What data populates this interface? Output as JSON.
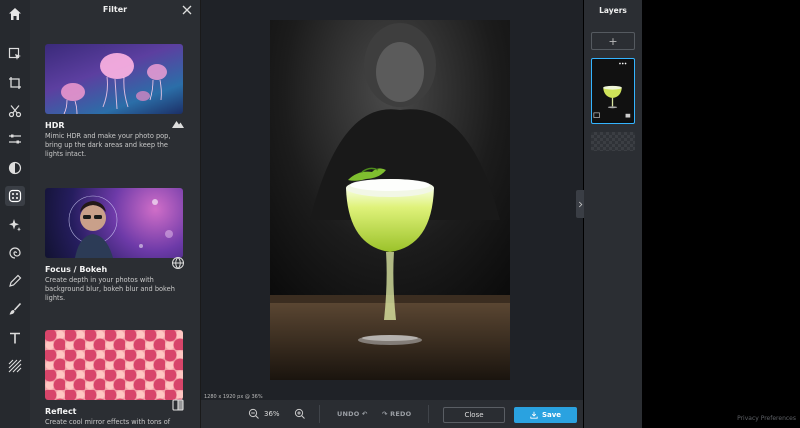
{
  "filter_panel": {
    "title": "Filter",
    "cards": [
      {
        "title": "HDR",
        "desc": "Mimic HDR and make your photo pop, bring up the dark areas and keep the lights intact.",
        "icon": "mountain-icon"
      },
      {
        "title": "Focus / Bokeh",
        "desc": "Create depth in your photos with background blur, bokeh blur and bokeh lights.",
        "icon": "globe-icon"
      },
      {
        "title": "Reflect",
        "desc": "Create cool mirror effects with tons of",
        "icon": "mirror-icon"
      }
    ]
  },
  "canvas": {
    "dimensions": "1280 x 1920 px @ 36%"
  },
  "bottom_bar": {
    "zoom": "36%",
    "undo": "UNDO",
    "redo": "REDO",
    "close": "Close",
    "save": "Save"
  },
  "layers_panel": {
    "title": "Layers",
    "add_label": "+"
  },
  "footer": {
    "privacy": "Privacy Preferences"
  },
  "colors": {
    "accent": "#2aa2e0",
    "panel": "#2b2e33",
    "rail": "#26292e",
    "selection": "#34b4ff"
  }
}
